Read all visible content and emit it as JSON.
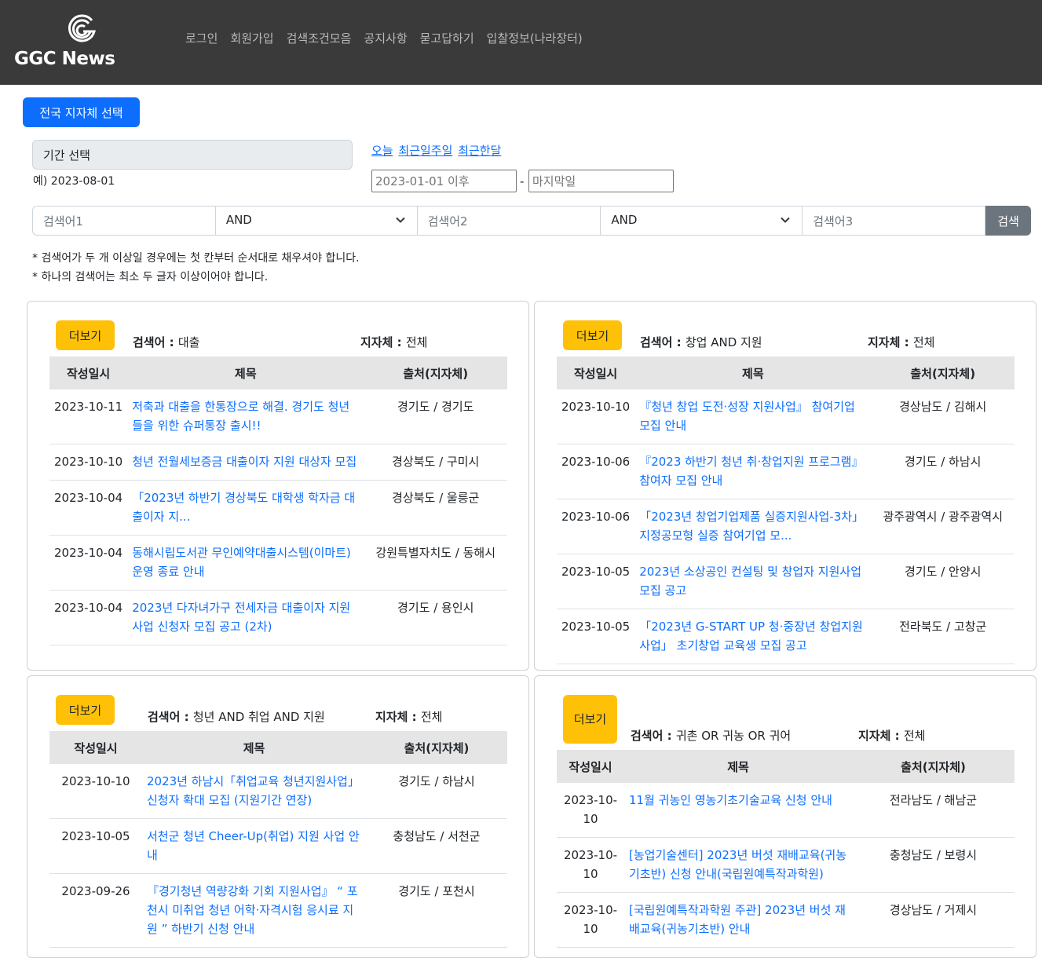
{
  "header": {
    "logo_text": "GGC News",
    "nav": [
      "로그인",
      "회원가입",
      "검색조건모음",
      "공지사항",
      "묻고답하기",
      "입찰정보(나라장터)"
    ]
  },
  "controls": {
    "region_button": "전국 지자체 선택",
    "period_label": "기간 선택",
    "period_example": "예) 2023-08-01",
    "quick_links": [
      "오늘",
      "최근일주일",
      "최근한달"
    ],
    "date_start_placeholder": "2023-01-01 이후",
    "date_separator": "-",
    "date_end_placeholder": "마지막일",
    "search1_placeholder": "검색어1",
    "op1": "AND",
    "search2_placeholder": "검색어2",
    "op2": "AND",
    "search3_placeholder": "검색어3",
    "search_button": "검색",
    "note1": "* 검색어가 두 개 이상일 경우에는 첫 칸부터 순서대로 채우셔야 합니다.",
    "note2": "* 하나의 검색어는 최소 두 글자 이상이어야 합니다."
  },
  "table_headers": {
    "date": "작성일시",
    "title": "제목",
    "source": "출처(지자체)"
  },
  "cards": [
    {
      "more": "더보기",
      "keyword_label": "검색어 : ",
      "keyword": "대출",
      "region_label": "지자체 : ",
      "region": "전체",
      "rows": [
        {
          "date": "2023-10-11",
          "title": "저축과 대출을 한통장으로 해결. 경기도 청년들을 위한 슈퍼통장 출시!!",
          "source": "경기도 / 경기도"
        },
        {
          "date": "2023-10-10",
          "title": "청년 전월세보증금 대출이자 지원 대상자 모집",
          "source": "경상북도 / 구미시"
        },
        {
          "date": "2023-10-04",
          "title": "「2023년 하반기 경상북도 대학생 학자금 대출이자 지...",
          "source": "경상북도 / 울릉군"
        },
        {
          "date": "2023-10-04",
          "title": "동해시립도서관 무인예약대출시스템(이마트) 운영 종료 안내",
          "source": "강원특별자치도 / 동해시"
        },
        {
          "date": "2023-10-04",
          "title": "2023년 다자녀가구 전세자금 대출이자 지원사업 신청자 모집 공고 (2차)",
          "source": "경기도 / 용인시"
        }
      ]
    },
    {
      "more": "더보기",
      "keyword_label": "검색어 : ",
      "keyword": "창업 AND 지원",
      "region_label": "지자체 : ",
      "region": "전체",
      "rows": [
        {
          "date": "2023-10-10",
          "title": "『청년 창업 도전·성장 지원사업』 참여기업 모집 안내",
          "source": "경상남도 / 김해시"
        },
        {
          "date": "2023-10-06",
          "title": "『2023 하반기 청년 취·창업지원 프로그램』참여자 모집 안내",
          "source": "경기도 / 하남시"
        },
        {
          "date": "2023-10-06",
          "title": "「2023년 창업기업제품 실증지원사업-3차」 지정공모형 실증 참여기업 모...",
          "source": "광주광역시 / 광주광역시"
        },
        {
          "date": "2023-10-05",
          "title": "2023년 소상공인 컨설팅 및 창업자 지원사업 모집 공고",
          "source": "경기도 / 안양시"
        },
        {
          "date": "2023-10-05",
          "title": "「2023년 G-START UP 청·중장년 창업지원사업」 초기창업 교육생 모집 공고",
          "source": "전라북도 / 고창군"
        }
      ]
    },
    {
      "more": "더보기",
      "keyword_label": "검색어 : ",
      "keyword": "청년 AND 취업 AND 지원",
      "region_label": "지자체 : ",
      "region": "전체",
      "rows": [
        {
          "date": "2023-10-10",
          "title": "2023년 하남시「취업교육 청년지원사업」 신청자 확대 모집 (지원기간 연장)",
          "source": "경기도 / 하남시"
        },
        {
          "date": "2023-10-05",
          "title": "서천군 청년 Cheer-Up(취업) 지원 사업 안내",
          "source": "충청남도 / 서천군"
        },
        {
          "date": "2023-09-26",
          "title": "『경기청년 역량강화 기회 지원사업』 “ 포천시 미취업 청년 어학·자격시험 응시료 지원 ” 하반기 신청 안내",
          "source": "경기도 / 포천시"
        }
      ]
    },
    {
      "more": "더보기",
      "keyword_label": "검색어 : ",
      "keyword": "귀촌 OR 귀농 OR 귀어",
      "region_label": "지자체 : ",
      "region": "전체",
      "rows": [
        {
          "date": "2023-10-10",
          "title": "11월 귀농인 영농기초기술교육 신청 안내",
          "source": "전라남도 / 해남군"
        },
        {
          "date": "2023-10-10",
          "title": "[농업기술센터] 2023년 버섯 재배교육(귀농기초반) 신청 안내(국립원예특작과학원)",
          "source": "충청남도 / 보령시"
        },
        {
          "date": "2023-10-10",
          "title": "[국립원예특작과학원 주관] 2023년 버섯 재배교육(귀농기초반) 안내",
          "source": "경상남도 / 거제시"
        }
      ]
    }
  ]
}
